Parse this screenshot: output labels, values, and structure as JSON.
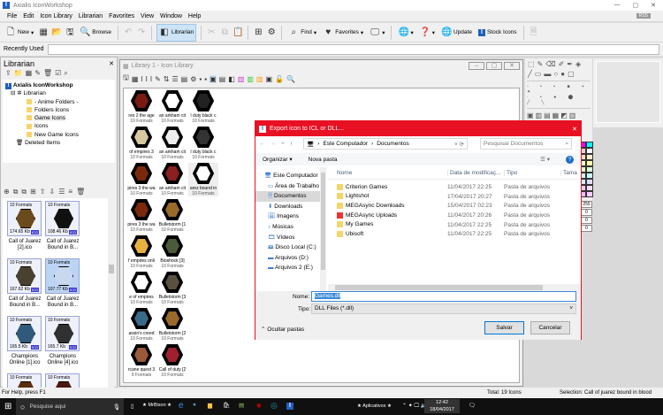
{
  "app": {
    "title": "Axialis IconWorkshop"
  },
  "menu": [
    "File",
    "Edit",
    "Icon Library",
    "Librarian",
    "Favorites",
    "View",
    "Window",
    "Help"
  ],
  "toolbar": {
    "new": "New",
    "browse": "Browse",
    "librarian": "Librarian",
    "find": "Find",
    "favorites": "Favorites",
    "update": "Update",
    "stock": "Stock Icons",
    "rss": "RSS"
  },
  "recent": {
    "label": "Recently Used",
    "value": ""
  },
  "librarian": {
    "title": "Librarian",
    "root": "Axialis IconWorkshop",
    "node": "Librarian",
    "folders": [
      "- Anime Folders -",
      "Folders Icons",
      "Game Icons",
      "Icons",
      "New Game Icons"
    ],
    "deleted": "Deleted Items",
    "thumbs": [
      {
        "formats": "10 Formats",
        "size": "174.65 Kb",
        "badge": "ICO",
        "name": "Call of Juarez [2].ico",
        "color": "#6b4a1c"
      },
      {
        "formats": "10 Formats",
        "size": "108.46 Kb",
        "badge": "ICO",
        "name": "Call of Juarez Bound in B...",
        "color": "#111111"
      },
      {
        "formats": "10 Formats",
        "size": "167.62 Kb",
        "badge": "ICO",
        "name": "Call of Juarez Bound in B...",
        "color": "#4a4030"
      },
      {
        "formats": "10 Formats",
        "size": "107.77 Kb",
        "badge": "ICO",
        "name": "Call of Juarez Bound in B...",
        "color": "#c8d8ee",
        "selected": true
      },
      {
        "formats": "10 Formats",
        "size": "165.5 Kb",
        "badge": "ICO",
        "name": "Champions Online [1].ico",
        "color": "#2f5a7a"
      },
      {
        "formats": "10 Formats",
        "size": "165.7 Kb",
        "badge": "ICO",
        "name": "Champions Online [4].ico",
        "color": "#303030"
      },
      {
        "formats": "10 Formats",
        "size": "",
        "badge": "",
        "name": "",
        "color": "#5a3010"
      },
      {
        "formats": "10 Formats",
        "size": "",
        "badge": "",
        "name": "",
        "color": "#4a1a10"
      }
    ]
  },
  "library": {
    "title": "Library 1 - Icon Library",
    "items": [
      {
        "name": "res 2 the age",
        "formats": "10 Formats",
        "color": "#7a1a10"
      },
      {
        "name": "an arkham cit",
        "formats": "10 Formats",
        "color": "#ffffff"
      },
      {
        "name": "l duty black c",
        "formats": "10 Formats",
        "color": "#222222"
      },
      {
        "name": "of empires 3",
        "formats": "10 Formats",
        "color": "#d8c9a0"
      },
      {
        "name": "an arkham cit",
        "formats": "10 Formats",
        "color": "#eeeeee"
      },
      {
        "name": "l duty black c",
        "formats": "10 Formats",
        "color": "#333333"
      },
      {
        "name": "pires 3 the wa",
        "formats": "10 Formats",
        "color": "#7a2a0a"
      },
      {
        "name": "an arkham cit",
        "formats": "10 Formats",
        "color": "#8a2020"
      },
      {
        "name": "arez bound in",
        "formats": "10 Formats",
        "color": "#ffffff"
      },
      {
        "name": "pires 3 the wa",
        "formats": "10 Formats",
        "color": "#7a2a0a"
      },
      {
        "name": "Bulletstorm [1",
        "formats": "10 Formats",
        "color": "#9a6a2a"
      },
      {
        "name": "f empires onli",
        "formats": "10 Formats",
        "color": "#e8b040"
      },
      {
        "name": "Bioshock [3]",
        "formats": "10 Formats",
        "color": "#4a5a3a"
      },
      {
        "name": "e of empires",
        "formats": "10 Formats",
        "color": "#ffffff"
      },
      {
        "name": "Bulletstorm [3",
        "formats": "10 Formats",
        "color": "#5a5040"
      },
      {
        "name": "assin's creed",
        "formats": "10 Formats",
        "color": "#3a6a8a"
      },
      {
        "name": "Bulletstorm [2",
        "formats": "10 Formats",
        "color": "#9a6a2a"
      },
      {
        "name": "rcane quest 3",
        "formats": "9 Formats",
        "color": "#9a5a3a"
      },
      {
        "name": "Call of duty [2",
        "formats": "10 Formats",
        "color": "#a02030"
      }
    ]
  },
  "dialog": {
    "title": "Export icon to ICL or DLL...",
    "path": [
      "Este Computador",
      "Documentos"
    ],
    "search_placeholder": "Pesquisar Documentos",
    "organize": "Organizar",
    "new_folder": "Nova pasta",
    "nav": [
      "Este Computador",
      "Área de Trabalho",
      "Documentos",
      "Downloads",
      "Imagens",
      "Músicas",
      "Vídeos",
      "Disco Local (C:)",
      "Arquivos (D:)",
      "Arquivos 2 (E:)"
    ],
    "columns": [
      "Nome",
      "Data de modificaç...",
      "Tipo",
      "Tama"
    ],
    "files": [
      {
        "name": "Criterion Games",
        "date": "11/04/2017 22:25",
        "type": "Pasta de arquivos"
      },
      {
        "name": "Lightshot",
        "date": "17/04/2017 20:27",
        "type": "Pasta de arquivos"
      },
      {
        "name": "MEGAsync Downloads",
        "date": "15/04/2017 02:23",
        "type": "Pasta de arquivos"
      },
      {
        "name": "MEGAsync Uploads",
        "date": "11/04/2017 20:26",
        "type": "Pasta de arquivos"
      },
      {
        "name": "My Games",
        "date": "11/04/2017 22:25",
        "type": "Pasta de arquivos"
      },
      {
        "name": "Ubisoft",
        "date": "11/04/2017 22:25",
        "type": "Pasta de arquivos"
      }
    ],
    "name_label": "Nome:",
    "name_value": "Games.dll",
    "type_label": "Tipo:",
    "type_value": "DLL Files (*.dll)",
    "hide_folders": "Ocultar pastas",
    "save": "Salvar",
    "cancel": "Cancelar"
  },
  "color_values": [
    "255",
    "0",
    "0",
    "0"
  ],
  "status": {
    "help": "For Help, press F1",
    "total": "Total: 19 Icons",
    "selection": "Selection: Call of juarez bound in blood"
  },
  "taskbar": {
    "search": "Pesquise aqui",
    "app": "★ MrBison ★",
    "apps_label": "★ Aplicativos ★",
    "time": "12:42",
    "date": "18/04/2017"
  }
}
